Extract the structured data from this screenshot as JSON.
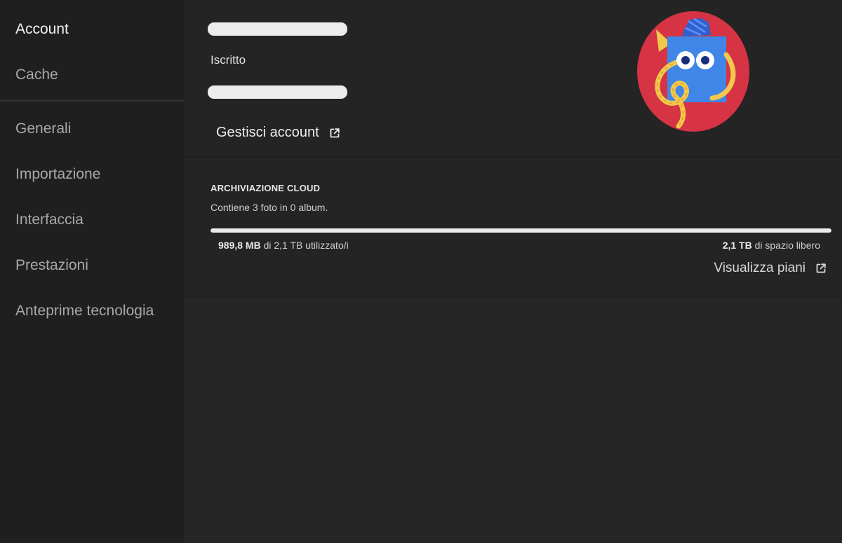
{
  "sidebar": {
    "items": [
      {
        "label": "Account",
        "active": true
      },
      {
        "label": "Cache"
      },
      {
        "label": "Generali"
      },
      {
        "label": "Importazione"
      },
      {
        "label": "Interfaccia"
      },
      {
        "label": "Prestazioni"
      },
      {
        "label": "Anteprime tecnologia"
      }
    ]
  },
  "account": {
    "plan_label": "Iscritto",
    "manage_link": "Gestisci account",
    "manage_icon": "external-link-icon"
  },
  "storage": {
    "title": "ARCHIVIAZIONE CLOUD",
    "subtitle": "Contiene 3 foto in 0 album.",
    "used_amount": "989,8 MB",
    "used_suffix": " di 2,1 TB utilizzato/i",
    "free_amount": "2,1 TB",
    "free_suffix": " di spazio libero",
    "usage_fraction": 1.0,
    "plans_link": "Visualizza piani",
    "plans_icon": "external-link-icon"
  },
  "colors": {
    "avatar_bg": "#d63344",
    "avatar_blue": "#3f86e6",
    "avatar_yellow": "#f2c84b"
  }
}
